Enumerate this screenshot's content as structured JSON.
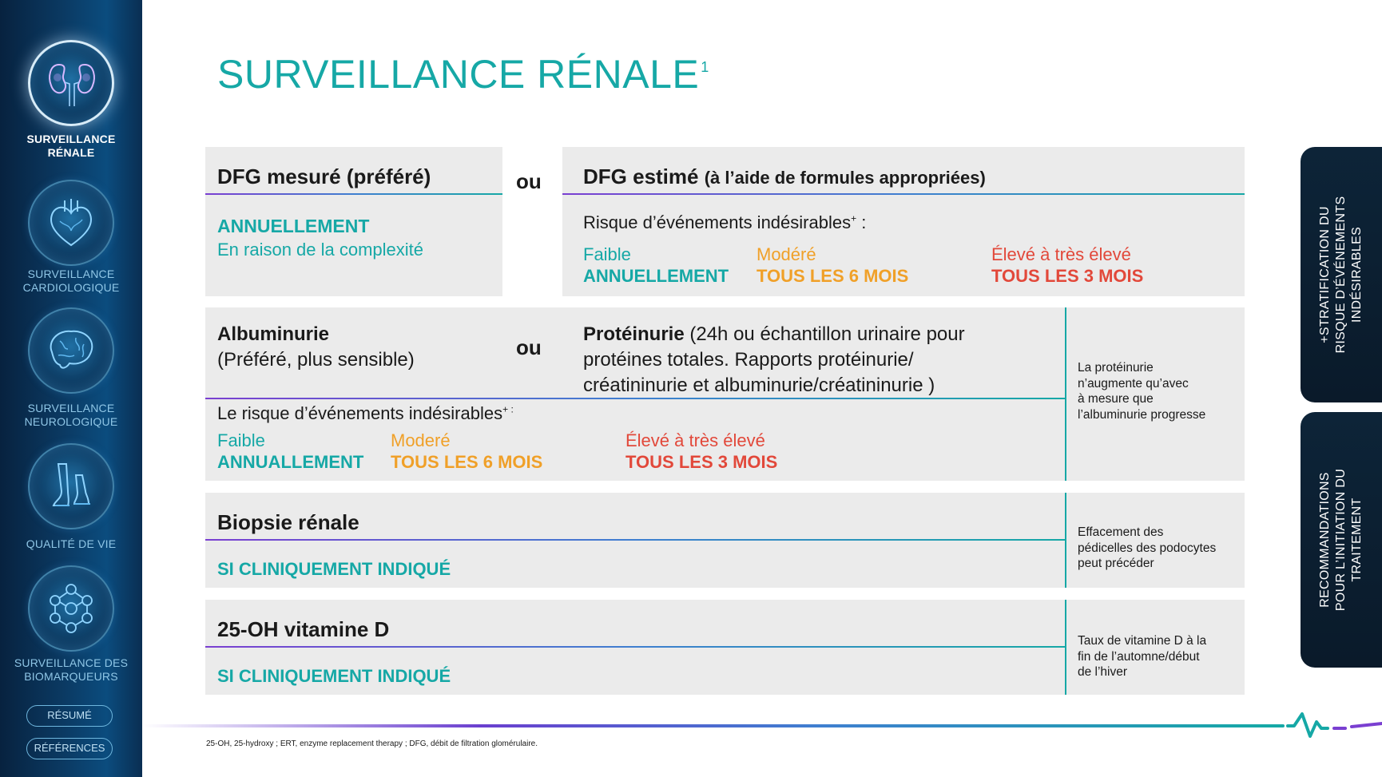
{
  "sidebar": {
    "items": [
      {
        "label_1": "SURVEILLANCE",
        "label_2": "RÉNALE",
        "icon": "kidneys-icon",
        "active": true
      },
      {
        "label_1": "SURVEILLANCE",
        "label_2": "CARDIOLOGIQUE",
        "icon": "heart-icon",
        "active": false
      },
      {
        "label_1": "SURVEILLANCE",
        "label_2": "NEUROLOGIQUE",
        "icon": "brain-icon",
        "active": false
      },
      {
        "label_1": "QUALITÉ DE VIE",
        "label_2": "",
        "icon": "feet-icon",
        "active": false
      },
      {
        "label_1": "SURVEILLANCE DES",
        "label_2": "BIOMARQUEURS",
        "icon": "molecule-icon",
        "active": false
      }
    ],
    "resume_label": "RÉSUMÉ",
    "references_label": "RÉFÉRENCES"
  },
  "title": {
    "text": "SURVEILLANCE RÉNALE",
    "superscript": "1"
  },
  "dfg": {
    "left_heading": "DFG mesuré (préféré)",
    "left_freq": "ANNUELLEMENT",
    "left_reason": "En raison de la complexité",
    "ou": "ou",
    "right_heading": "DFG estimé",
    "right_heading_small": "(à l’aide de formules appropriées)",
    "risk_label": "Risque d’événements indésirables",
    "risk_label_sup": "+",
    "risk_label_end": " :",
    "levels": [
      {
        "label": "Faible",
        "freq": "ANNUELLEMENT"
      },
      {
        "label": "Modéré",
        "freq": "TOUS LES 6 MOIS"
      },
      {
        "label": "Élevé à très élevé",
        "freq": "TOUS LES 3 MOIS"
      }
    ]
  },
  "albumin": {
    "heading": "Albuminurie",
    "subheading": "(Préféré, plus sensible)",
    "ou": "ou",
    "prot_heading": "Protéinurie",
    "prot_line1": " (24h ou échantillon urinaire pour",
    "prot_line2": "protéines totales. Rapports protéinurie/",
    "prot_line3": "créatininurie et albuminurie/créatininurie )",
    "risk_label": "Le risque d’événements indésirables",
    "risk_label_sup": "+ :",
    "levels": [
      {
        "label": "Faible",
        "freq": "ANNUALLEMENT"
      },
      {
        "label": "Moderé",
        "freq": "TOUS LES 6 MOIS"
      },
      {
        "label": "Élevé à très élevé",
        "freq": "TOUS LES 3 MOIS"
      }
    ],
    "note": [
      "La protéinurie",
      "n’augmente qu’avec",
      "à mesure que",
      "l’albuminurie progresse"
    ]
  },
  "biopsy": {
    "heading": "Biopsie rénale",
    "freq": "SI CLINIQUEMENT INDIQUÉ",
    "note": [
      "Effacement des",
      "pédicelles des podocytes",
      "peut précéder"
    ]
  },
  "vitd": {
    "heading": "25-OH vitamine D",
    "freq": "SI CLINIQUEMENT INDIQUÉ",
    "note": [
      "Taux de vitamine D à la",
      "fin de l’automne/début",
      "de l’hiver"
    ]
  },
  "tabs": {
    "stratification": [
      "+STRATIFICATION DU",
      "RISQUE D’ÉVÉNEMENTS",
      "INDÉSIRABLES"
    ],
    "recommandations": [
      "RECOMMANDATIONS",
      "POUR L’INITIATION DU",
      "TRAITEMENT"
    ]
  },
  "footnote": "25-OH, 25-hydroxy ; ERT, enzyme replacement therapy ; DFG, débit de filtration glomérulaire.",
  "colors": {
    "teal": "#16a8a6",
    "orange": "#f0a028",
    "red": "#e2483a",
    "purple": "#7a3fd1",
    "navy": "#0b3a63"
  }
}
